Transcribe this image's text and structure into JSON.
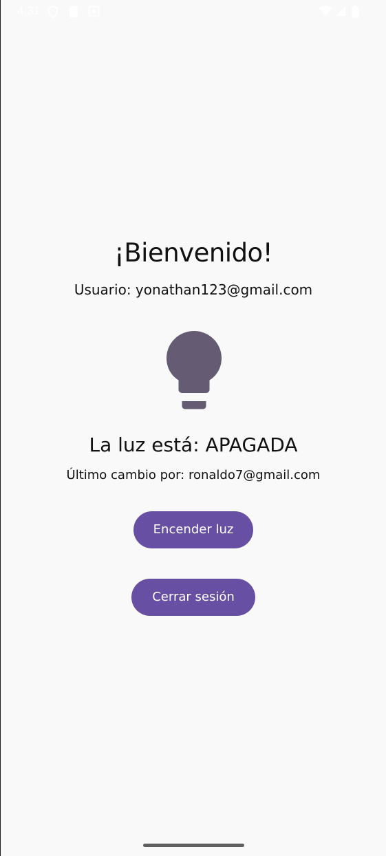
{
  "status_bar": {
    "time": "4:31",
    "left_icons": [
      "shield-icon",
      "sim-card-icon",
      "settings-icon"
    ],
    "right_icons": [
      "wifi-icon",
      "signal-icon",
      "battery-icon"
    ]
  },
  "welcome": {
    "title": "¡Bienvenido!",
    "user_line": "Usuario: yonathan123@gmail.com"
  },
  "light": {
    "icon": "lightbulb-icon",
    "icon_color": "#655b73",
    "status": "La luz está: APAGADA",
    "last_change": "Último cambio por: ronaldo7@gmail.com"
  },
  "actions": {
    "toggle_label": "Encender luz",
    "logout_label": "Cerrar sesión",
    "button_color": "#6750a4"
  }
}
